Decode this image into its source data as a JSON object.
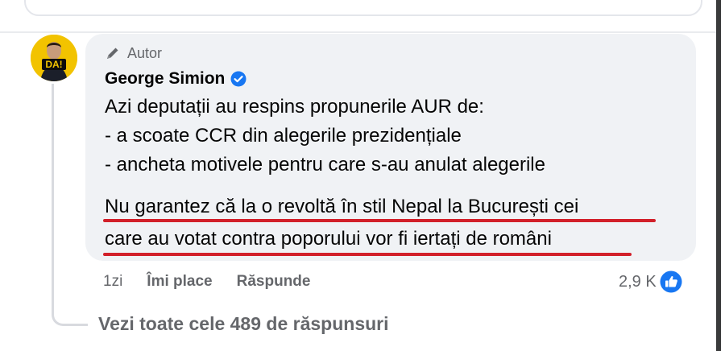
{
  "comment": {
    "badge_label": "Autor",
    "author_name": "George Simion",
    "avatar_text": "DA!",
    "body_lines": [
      "Azi deputații au respins propunerile AUR de:",
      "- a scoate CCR din alegerile prezidențiale",
      "- ancheta motivele pentru care s-au anulat alegerile",
      "Nu garantez că la o revoltă în stil Nepal la București cei",
      "care au votat contra poporului vor fi iertați de români"
    ],
    "time": "1zi",
    "like_label": "Îmi place",
    "reply_label": "Răspunde",
    "reaction_count": "2,9 K"
  },
  "view_replies_label": "Vezi toate cele 489 de răspunsuri",
  "colors": {
    "bubble_bg": "#f0f2f5",
    "meta_text": "#65676b",
    "verified_blue": "#1877f2",
    "underline_red": "#d2202a",
    "avatar_yellow": "#f2c300"
  },
  "icons": {
    "badge": "pencil-icon",
    "verified": "verified-badge-icon",
    "reaction": "like-thumb-icon"
  }
}
